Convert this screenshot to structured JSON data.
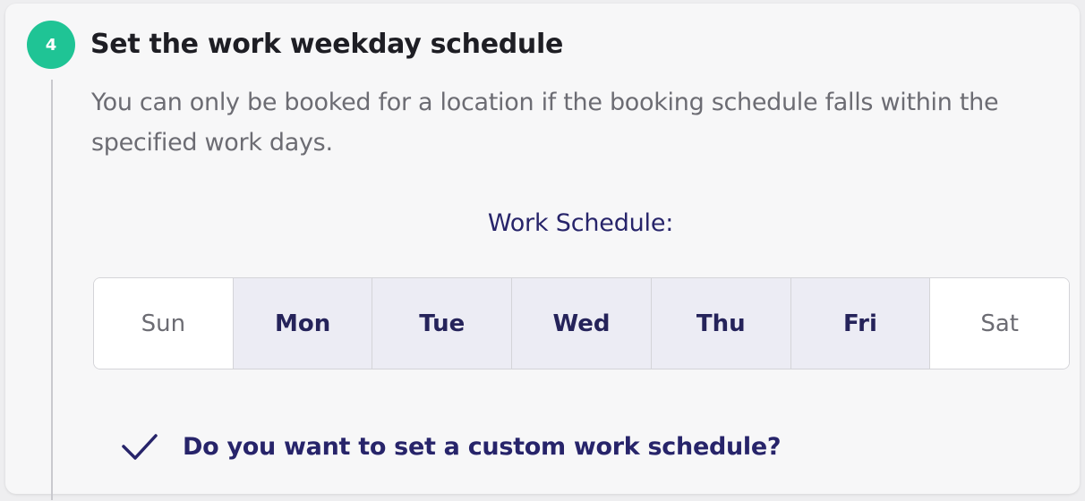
{
  "step": {
    "number": "4",
    "title": "Set the work weekday schedule",
    "description": "You can only be booked for a location if the booking schedule falls within the specified work days."
  },
  "schedule": {
    "label": "Work Schedule:",
    "days": [
      {
        "label": "Sun",
        "selected": false
      },
      {
        "label": "Mon",
        "selected": true
      },
      {
        "label": "Tue",
        "selected": true
      },
      {
        "label": "Wed",
        "selected": true
      },
      {
        "label": "Thu",
        "selected": true
      },
      {
        "label": "Fri",
        "selected": true
      },
      {
        "label": "Sat",
        "selected": false
      }
    ]
  },
  "custom_schedule": {
    "question": "Do you want to set a custom work schedule?",
    "icon": "checkmark-icon"
  },
  "colors": {
    "badge": "#1fc495",
    "accent_text": "#27246a",
    "selected_day_bg": "#ececf4"
  }
}
